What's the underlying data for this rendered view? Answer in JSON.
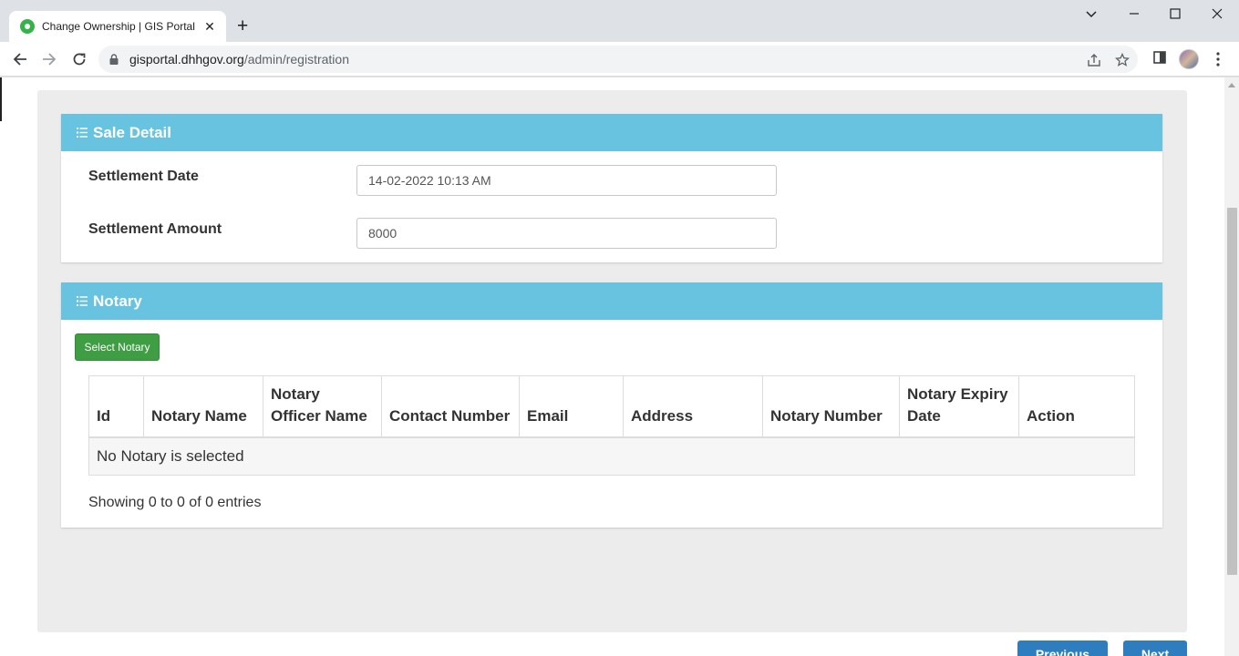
{
  "browser": {
    "tab_title": "Change Ownership | GIS Portal",
    "tab_close": "✕",
    "new_tab": "+",
    "url_host": "gisportal.dhhgov.org",
    "url_path": "/admin/registration"
  },
  "sale_detail": {
    "title": "Sale Detail",
    "settlement_date_label": "Settlement Date",
    "settlement_date_value": "14-02-2022 10:13 AM",
    "settlement_amount_label": "Settlement Amount",
    "settlement_amount_value": "8000"
  },
  "notary": {
    "title": "Notary",
    "select_button": "Select Notary",
    "columns": [
      "Id",
      "Notary Name",
      "Notary Officer Name",
      "Contact Number",
      "Email",
      "Address",
      "Notary Number",
      "Notary Expiry Date",
      "Action"
    ],
    "empty_message": "No Notary is selected",
    "info": "Showing 0 to 0 of 0 entries"
  },
  "footer": {
    "previous_label": "Previous",
    "next_label": "Next"
  },
  "colors": {
    "panel_header": "#67c3df",
    "select_button": "#3f9e44",
    "nav_button": "#2e7dbf"
  }
}
